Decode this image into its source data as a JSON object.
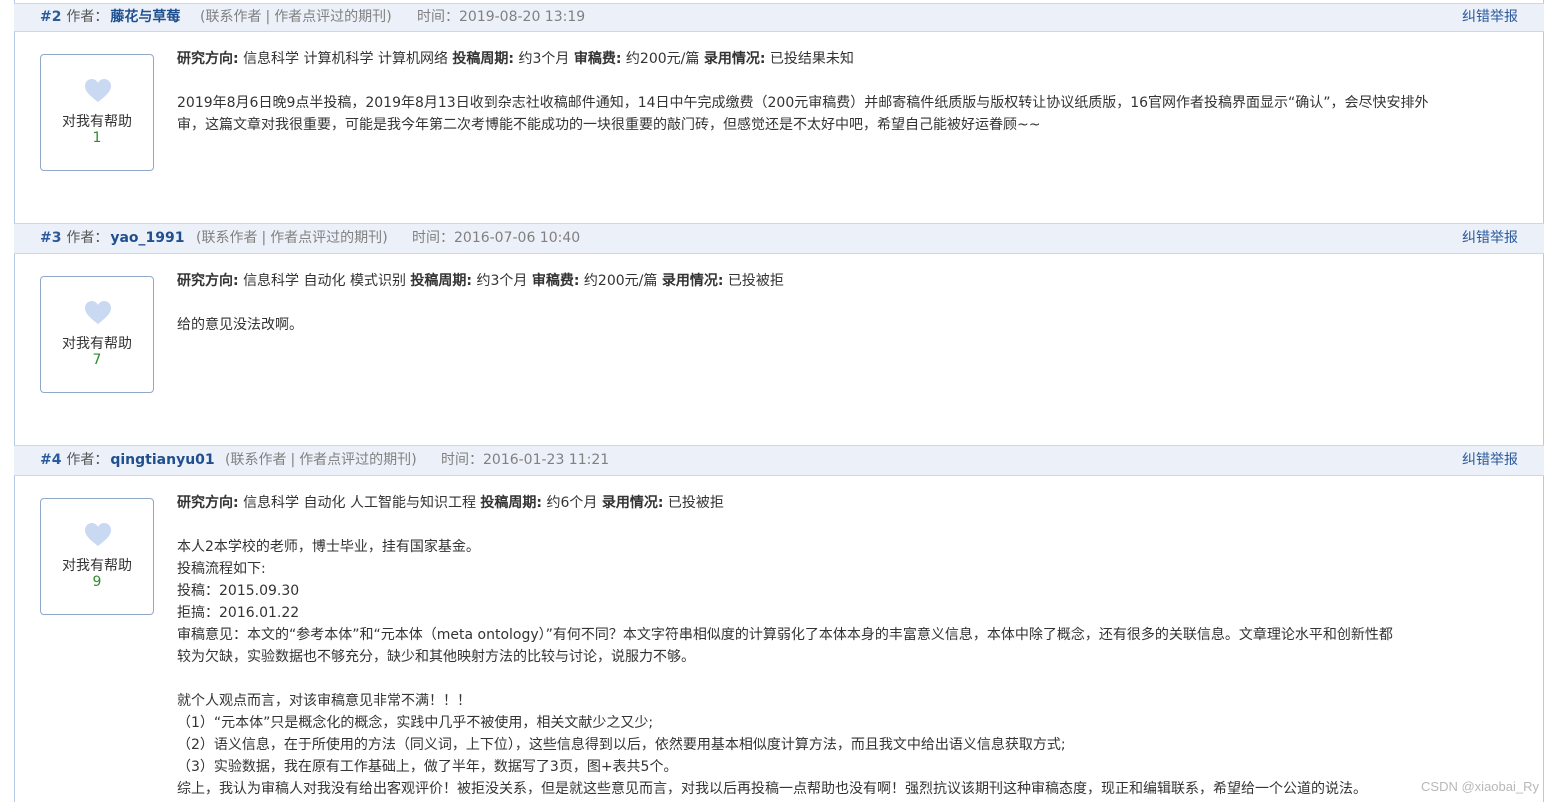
{
  "ui": {
    "author_label": "作者：",
    "contact_label": "联系作者",
    "journals_label": "作者点评过的期刊",
    "time_label": "时间：",
    "report_label": "纠错举报",
    "helpful_label": "对我有帮助",
    "field_label": "研究方向:",
    "cycle_label": "投稿周期:",
    "fee_label": "审稿费:",
    "status_label": "录用情况:"
  },
  "posts": [
    {
      "num": "#2",
      "author": "藤花与草莓",
      "time": "2019-08-20 13:19",
      "helpful_count": "1",
      "field": "信息科学 计算机科学 计算机网络",
      "cycle": "约3个月",
      "fee": "约200元/篇",
      "status": "已投结果未知",
      "lines": [
        "2019年8月6日晚9点半投稿，2019年8月13日收到杂志社收稿邮件通知，14日中午完成缴费（200元审稿费）并邮寄稿件纸质版与版权转让协议纸质版，16官网作者投稿界面显示“确认”，会尽快安排外",
        "审，这篇文章对我很重要，可能是我今年第二次考博能不能成功的一块很重要的敲门砖，但感觉还是不太好中吧，希望自己能被好运眷顾~~"
      ]
    },
    {
      "num": "#3",
      "author": "yao_1991",
      "time": "2016-07-06 10:40",
      "helpful_count": "7",
      "field": "信息科学 自动化 模式识别",
      "cycle": "约3个月",
      "fee": "约200元/篇",
      "status": "已投被拒",
      "lines": [
        "给的意见没法改啊。"
      ]
    },
    {
      "num": "#4",
      "author": "qingtianyu01",
      "time": "2016-01-23 11:21",
      "helpful_count": "9",
      "field": "信息科学 自动化 人工智能与知识工程",
      "cycle": "约6个月",
      "status": "已投被拒",
      "lines": [
        "本人2本学校的老师，博士毕业，挂有国家基金。",
        "投稿流程如下:",
        "投稿：2015.09.30",
        "拒搞：2016.01.22",
        "审稿意见：本文的“参考本体”和“元本体（meta ontology）”有何不同？本文字符串相似度的计算弱化了本体本身的丰富意义信息，本体中除了概念，还有很多的关联信息。文章理论水平和创新性都",
        "较为欠缺，实验数据也不够充分，缺少和其他映射方法的比较与讨论，说服力不够。",
        "",
        "就个人观点而言，对该审稿意见非常不满！！！",
        "（1）“元本体”只是概念化的概念，实践中几乎不被使用，相关文献少之又少;",
        "（2）语义信息，在于所使用的方法（同义词，上下位），这些信息得到以后，依然要用基本相似度计算方法，而且我文中给出语义信息获取方式;",
        "（3）实验数据，我在原有工作基础上，做了半年，数据写了3页，图+表共5个。",
        "综上，我认为审稿人对我没有给出客观评价！被拒没关系，但是就这些意见而言，对我以后再投稿一点帮助也没有啊！强烈抗议该期刊这种审稿态度，现正和编辑联系，希望给一个公道的说法。"
      ]
    }
  ],
  "watermark": "CSDN @xiaobai_Ry",
  "colors": {
    "header_bg": "#ecf1f9",
    "author_link": "#1f4f8f",
    "heart": "#c9d9f2",
    "count_green": "#2e8b2e"
  }
}
